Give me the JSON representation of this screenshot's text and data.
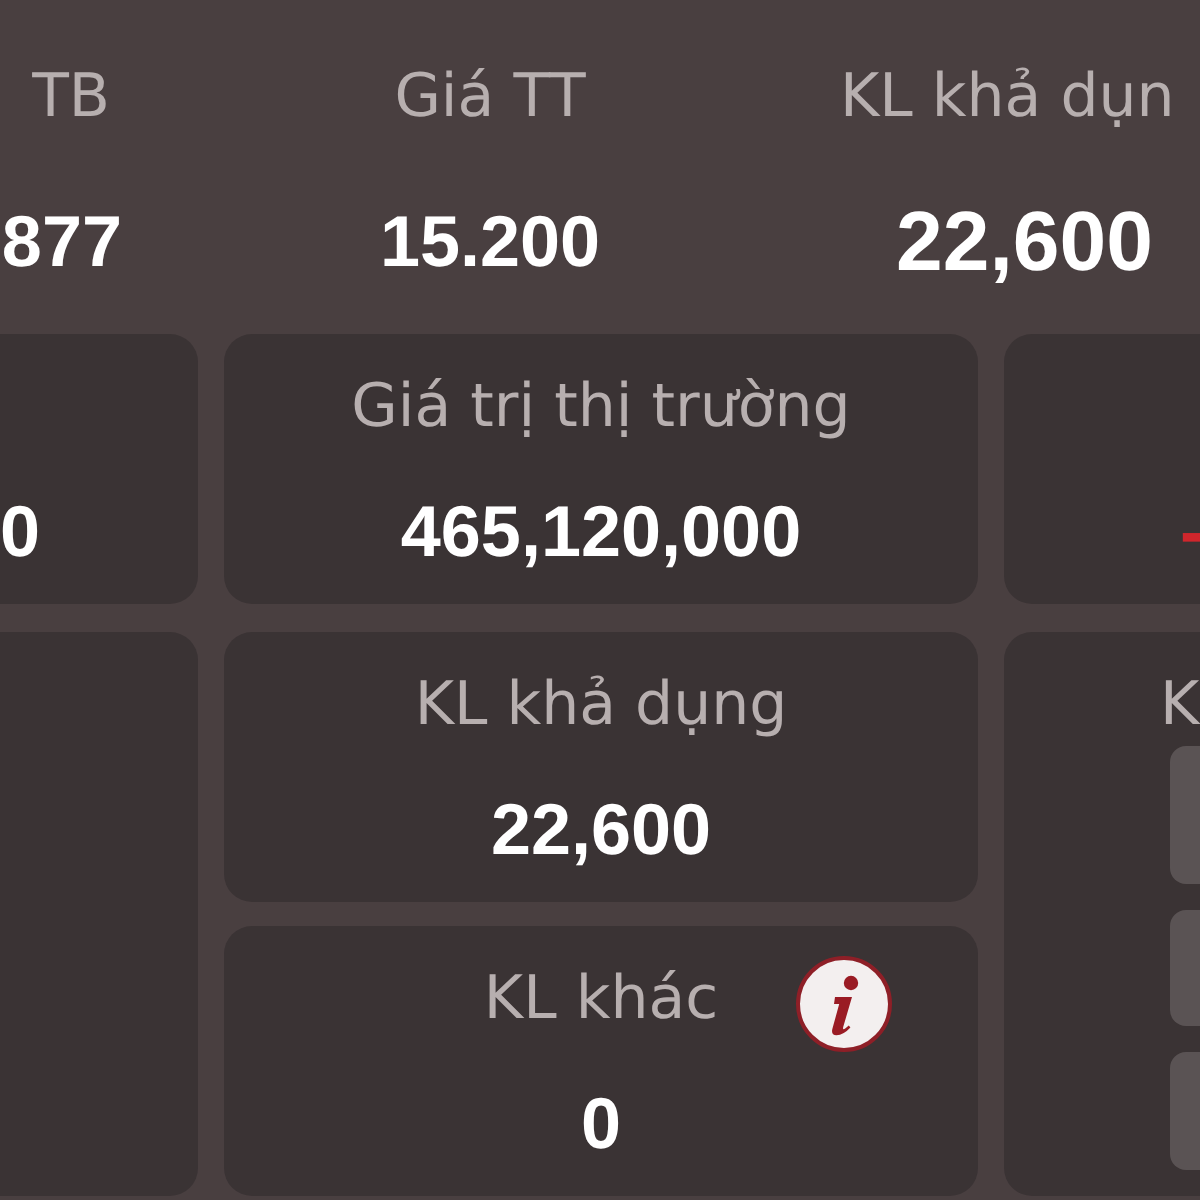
{
  "summary": [
    {
      "label": "TB",
      "value": "877"
    },
    {
      "label": "Giá TT",
      "value": "15.200"
    },
    {
      "label": "KL khả dụn",
      "value": "22,600"
    }
  ],
  "rows": [
    {
      "cards": [
        {
          "kind": "value",
          "value": "0",
          "negative": false
        },
        {
          "kind": "stat",
          "label": "Giá trị thị trường",
          "value": "465,120,000"
        },
        {
          "kind": "value",
          "value": "-",
          "negative": true
        }
      ]
    },
    {
      "cards": [
        {
          "kind": "blank"
        },
        {
          "kind": "stack",
          "items": [
            {
              "label": "KL khả dụng",
              "value": "22,600",
              "info": false
            },
            {
              "label": "KL khác",
              "value": "0",
              "info": true
            }
          ]
        },
        {
          "kind": "form",
          "label": "K",
          "fields": [
            {
              "kind": "input"
            },
            {
              "kind": "input"
            },
            {
              "kind": "input"
            }
          ]
        }
      ]
    }
  ]
}
